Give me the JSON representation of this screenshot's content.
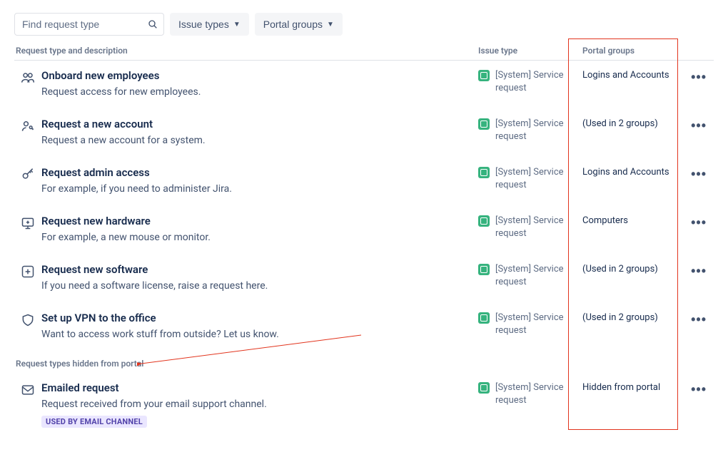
{
  "toolbar": {
    "search_placeholder": "Find request type",
    "issue_types_label": "Issue types",
    "portal_groups_label": "Portal groups"
  },
  "headers": {
    "main": "Request type and description",
    "issue": "Issue type",
    "portal": "Portal groups"
  },
  "issue_type_label": "[System] Service request",
  "rows": [
    {
      "icon": "people-icon",
      "title": "Onboard new employees",
      "desc": "Request access for new employees.",
      "portal": "Logins and Accounts"
    },
    {
      "icon": "person-key-icon",
      "title": "Request a new account",
      "desc": "Request a new account for a system.",
      "portal": "(Used in 2 groups)"
    },
    {
      "icon": "key-icon",
      "title": "Request admin access",
      "desc": "For example, if you need to administer Jira.",
      "portal": "Logins and Accounts"
    },
    {
      "icon": "monitor-add-icon",
      "title": "Request new hardware",
      "desc": "For example, a new mouse or monitor.",
      "portal": "Computers"
    },
    {
      "icon": "app-add-icon",
      "title": "Request new software",
      "desc": "If you need a software license, raise a request here.",
      "portal": "(Used in 2 groups)"
    },
    {
      "icon": "shield-icon",
      "title": "Set up VPN to the office",
      "desc": "Want to access work stuff from outside? Let us know.",
      "portal": "(Used in 2 groups)"
    }
  ],
  "hidden_section_label": "Request types hidden from portal",
  "hidden_rows": [
    {
      "icon": "mail-icon",
      "title": "Emailed request",
      "desc": "Request received from your email support channel.",
      "portal": "Hidden from portal",
      "badge": "USED BY EMAIL CHANNEL"
    }
  ]
}
